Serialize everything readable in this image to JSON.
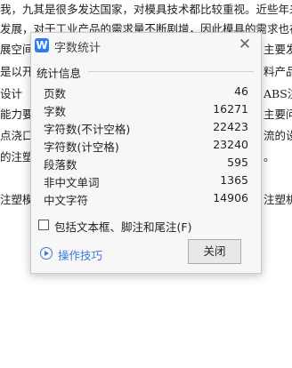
{
  "background_doc": {
    "lines": [
      "我，九其是很多发达国家，对模具技术都比较重视。近些年来",
      "发展，对于工业产品的需求量不断剧增，因此模具的需求也在",
      "展空间",
      "是以开",
      "设计",
      "能力要",
      "点浇口",
      "的注塑",
      "注塑模"
    ],
    "right_fragments": [
      "主要发",
      "料产品",
      "ABS注",
      "主要问",
      "流的设",
      "。",
      "注塑机"
    ]
  },
  "dialog": {
    "title": "字数统计",
    "app_icon": "W",
    "close_symbol": "✕",
    "section_label": "统计信息",
    "stats": [
      {
        "label": "页数",
        "value": "46"
      },
      {
        "label": "字数",
        "value": "16271"
      },
      {
        "label": "字符数(不计空格)",
        "value": "22423"
      },
      {
        "label": "字符数(计空格)",
        "value": "23240"
      },
      {
        "label": "段落数",
        "value": "595"
      },
      {
        "label": "非中文单词",
        "value": "1365"
      },
      {
        "label": "中文字符",
        "value": "14906"
      }
    ],
    "checkbox_label": "包括文本框、脚注和尾注(F)",
    "tips_label": "操作技巧",
    "close_button_label": "关闭"
  },
  "colors": {
    "accent": "#3a7ad9",
    "app_icon": "#2b7cf6"
  }
}
